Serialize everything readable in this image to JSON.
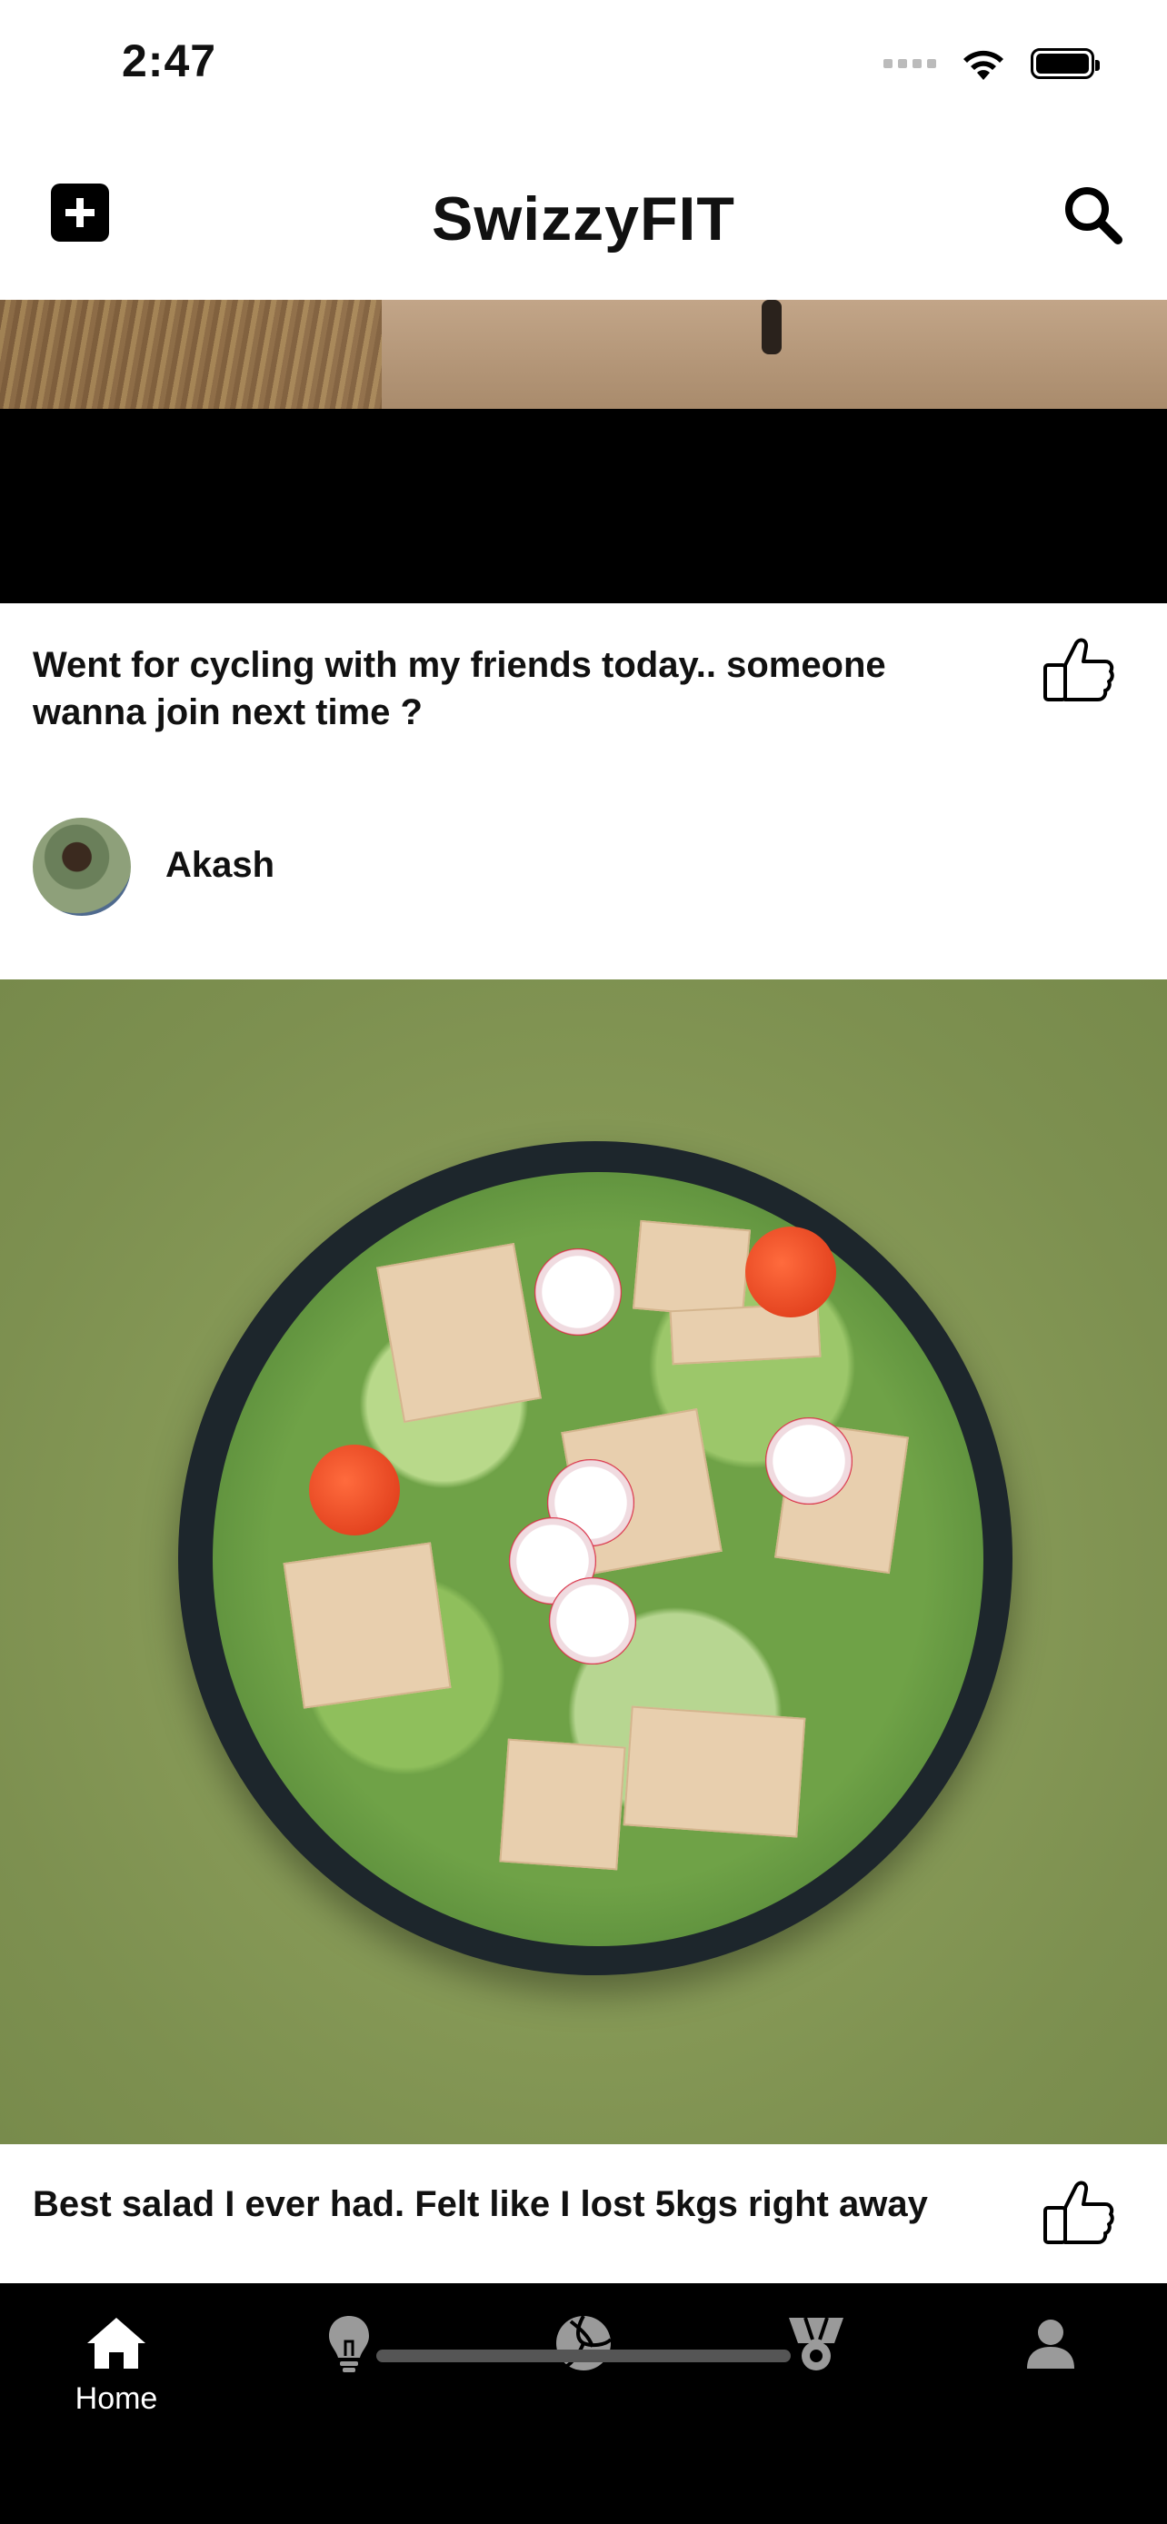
{
  "status_bar": {
    "time": "2:47"
  },
  "header": {
    "title": "SwizzyFIT"
  },
  "posts": [
    {
      "caption": "Went for cycling with my friends today.. someone wanna join next time ?",
      "author": "Akash"
    },
    {
      "caption": "Best salad I ever had. Felt like I lost 5kgs right away"
    }
  ],
  "bottom_nav": {
    "items": [
      {
        "label": "Home",
        "icon": "home-icon"
      },
      {
        "label": "",
        "icon": "lightbulb-icon"
      },
      {
        "label": "",
        "icon": "volleyball-icon"
      },
      {
        "label": "",
        "icon": "medal-icon"
      },
      {
        "label": "",
        "icon": "profile-icon"
      }
    ]
  },
  "colors": {
    "nav_bg": "#000000",
    "icon_inactive": "#9a9a9a",
    "icon_active": "#ffffff"
  }
}
